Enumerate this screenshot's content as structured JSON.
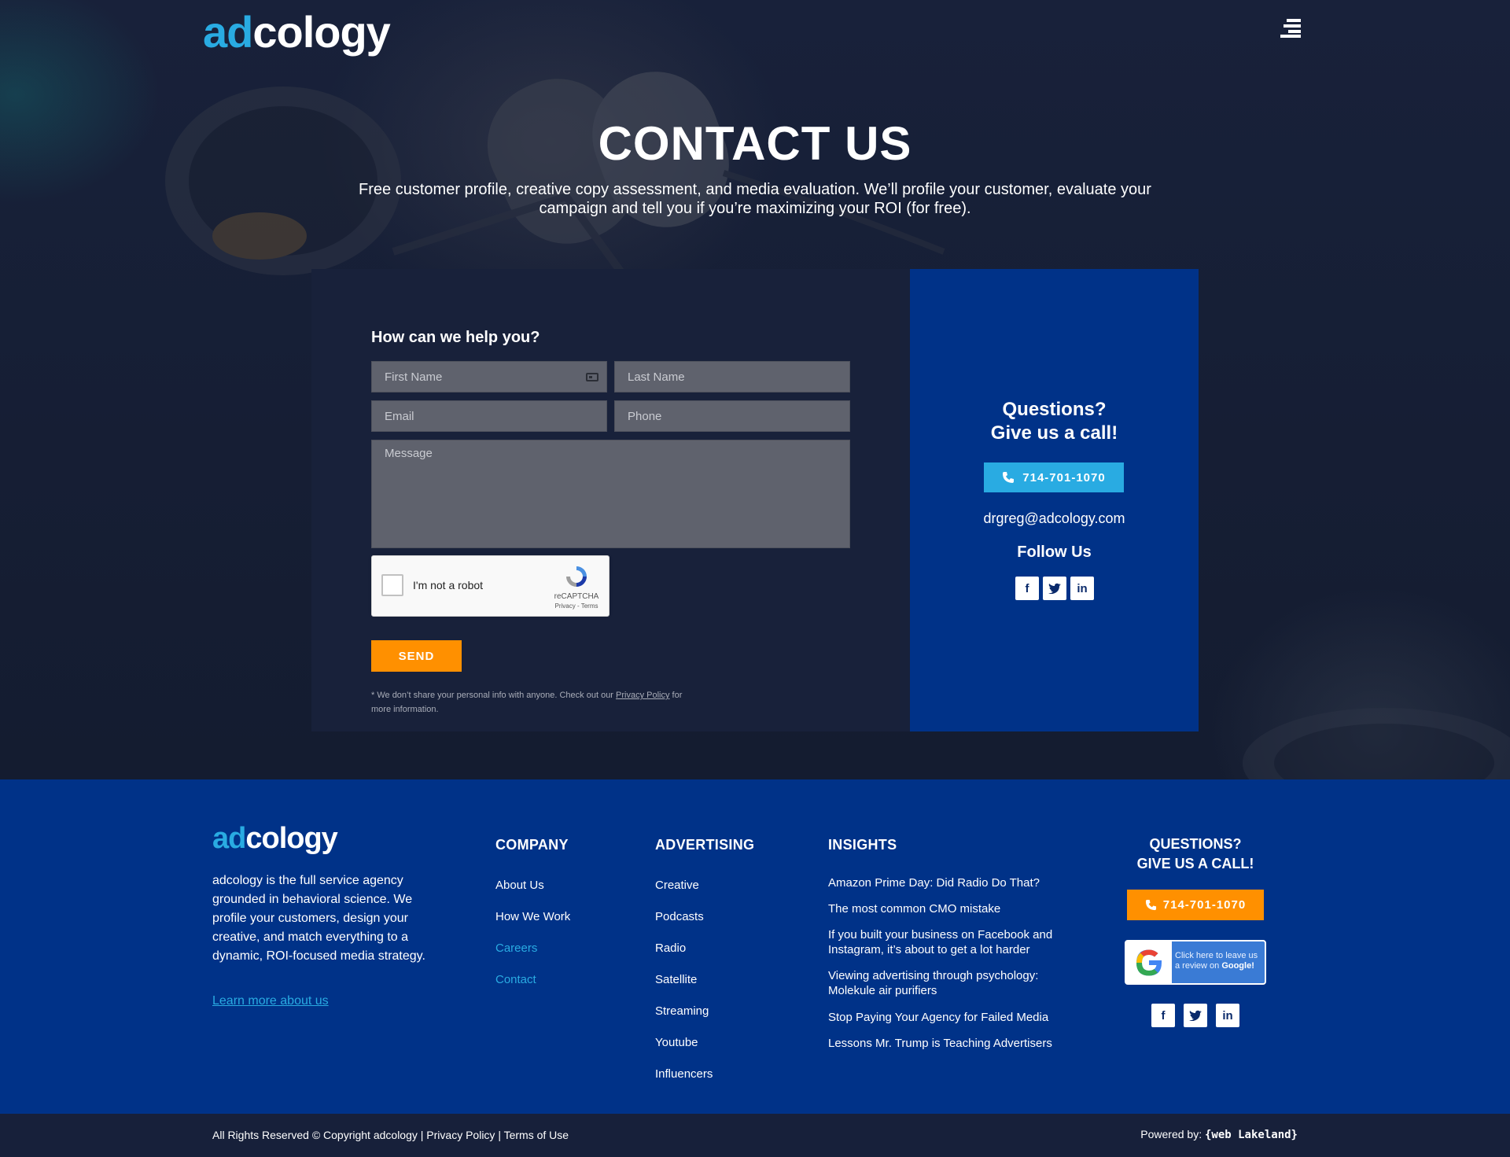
{
  "header": {
    "logo_part1": "ad",
    "logo_part2": "cology",
    "menu_icon": "hamburger-menu-icon"
  },
  "hero": {
    "title": "CONTACT US",
    "subtitle": "Free customer profile, creative copy assessment, and media evaluation. We’ll profile your customer, evaluate your campaign and tell you if you’re maximizing your ROI (for free)."
  },
  "form": {
    "heading": "How can we help you?",
    "first_name_placeholder": "First Name",
    "last_name_placeholder": "Last Name",
    "email_placeholder": "Email",
    "phone_placeholder": "Phone",
    "message_placeholder": "Message",
    "recaptcha_label": "I'm not a robot",
    "recaptcha_brand": "reCAPTCHA",
    "recaptcha_links": "Privacy - Terms",
    "send_label": "SEND",
    "disclaimer_pre": "* We don’t share your personal info with anyone. Check out our ",
    "disclaimer_link": "Privacy Policy",
    "disclaimer_post": " for more information."
  },
  "contact_card": {
    "title_line1": "Questions?",
    "title_line2": "Give us a call!",
    "phone": "714-701-1070",
    "email": "drgreg@adcology.com",
    "follow": "Follow Us",
    "socials": [
      "f",
      "t",
      "in"
    ]
  },
  "footer": {
    "logo_part1": "ad",
    "logo_part2": "cology",
    "about": "adcology is the full service agency grounded in behavioral science. We profile your customers, design your creative, and match everything to a dynamic, ROI-focused media strategy.",
    "learn_more": "Learn more about us",
    "company": {
      "title": "COMPANY",
      "links": [
        "About Us",
        "How We Work",
        "Careers",
        "Contact"
      ]
    },
    "advertising": {
      "title": "ADVERTISING",
      "links": [
        "Creative",
        "Podcasts",
        "Radio",
        "Satellite",
        "Streaming",
        "Youtube",
        "Influencers"
      ]
    },
    "insights": {
      "title": "INSIGHTS",
      "links": [
        "Amazon Prime Day: Did Radio Do That?",
        "The most common CMO mistake",
        "If you built your business on Facebook and Instagram, it’s about to get a lot harder",
        "Viewing advertising through psychology: Molekule air purifiers",
        "Stop Paying Your Agency for Failed Media",
        "Lessons Mr. Trump is Teaching Advertisers"
      ]
    },
    "questions": {
      "title_line1": "QUESTIONS?",
      "title_line2": "GIVE US A CALL!",
      "phone": "714-701-1070",
      "google_text_1": "Click here to leave us",
      "google_text_2": "a review on ",
      "google_text_3": "Google!"
    }
  },
  "bottom": {
    "copyright": "All Rights Reserved © Copyright adcology  | Privacy Policy | Terms of Use",
    "powered_by": "Powered by: ",
    "powered_brand": "{web Lakeland}"
  },
  "colors": {
    "accent_cyan": "#29abe2",
    "accent_orange": "#ff9000",
    "brand_blue": "#003288",
    "dark_navy": "#17203a"
  }
}
